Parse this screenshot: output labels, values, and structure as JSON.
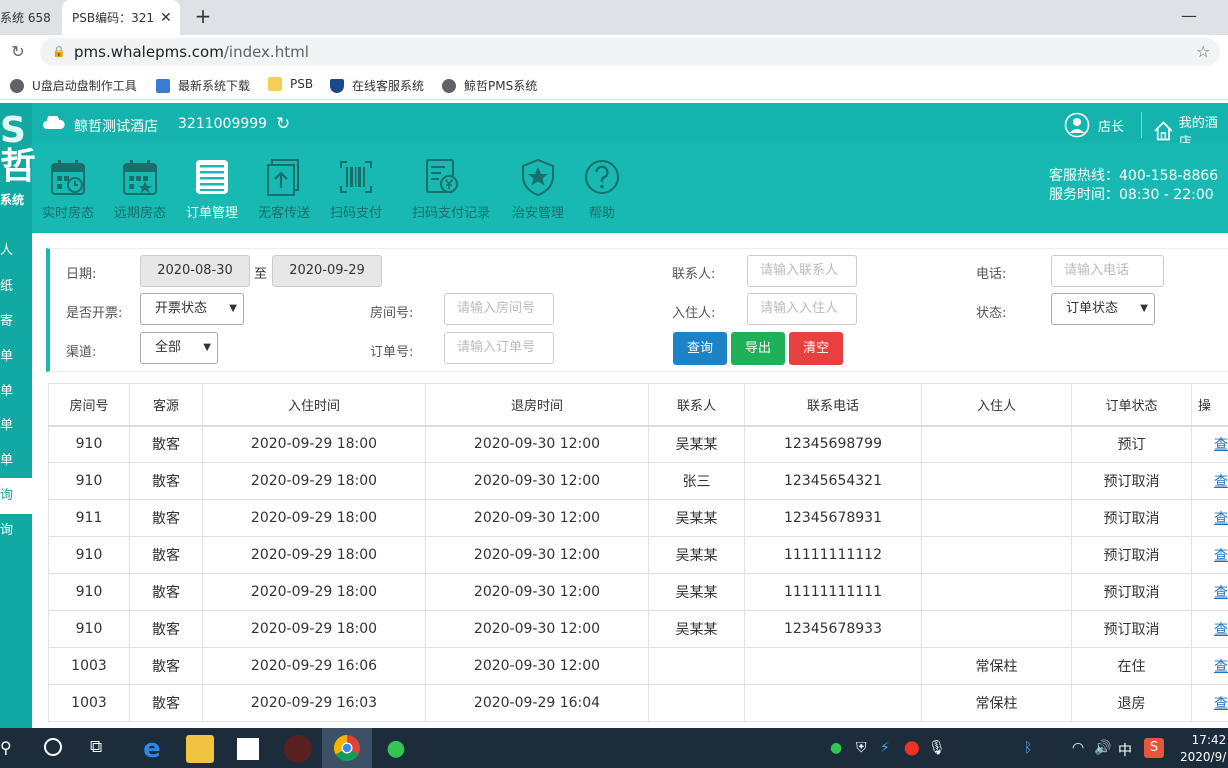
{
  "browser": {
    "tabs": [
      {
        "label": "系统  658",
        "active": false
      },
      {
        "label": "PSB编码：321",
        "active": true
      }
    ],
    "url_host": "pms.whalepms.com",
    "url_path": "/index.html",
    "bookmarks": [
      "U盘启动盘制作工具",
      "最新系统下载",
      "PSB",
      "在线客服系统",
      "鲸哲PMS系统"
    ]
  },
  "header": {
    "hotel_name": "鲸哲测试酒店",
    "hotel_code": "3211009999",
    "user": "店长",
    "my_store": "我的酒店",
    "logo_text": "S 哲",
    "logo_sub": "系统"
  },
  "nav": {
    "items": [
      {
        "label": "实时房态",
        "icon": "calendar-clock-icon"
      },
      {
        "label": "远期房态",
        "icon": "calendar-star-icon"
      },
      {
        "label": "订单管理",
        "icon": "list-icon"
      },
      {
        "label": "无客传送",
        "icon": "upload-icon"
      },
      {
        "label": "扫码支付",
        "icon": "barcode-icon"
      },
      {
        "label": "扫码支付记录",
        "icon": "receipt-yen-icon"
      },
      {
        "label": "治安管理",
        "icon": "shield-star-icon"
      },
      {
        "label": "帮助",
        "icon": "help-icon"
      }
    ],
    "active": "订单管理",
    "hotline": "客服热线：400-158-8866",
    "service_time": "服务时间：08:30 - 22:00"
  },
  "rail": [
    "人",
    "纸",
    "寄",
    "单",
    "单",
    "单",
    "单",
    "询",
    "询"
  ],
  "filter": {
    "date_label": "日期:",
    "date_from": "2020-08-30",
    "date_sep": "至",
    "date_to": "2020-09-29",
    "contact_label": "联系人:",
    "contact_placeholder": "请输入联系人",
    "phone_label": "电话:",
    "phone_placeholder": "请输入电话",
    "invoice_label": "是否开票:",
    "invoice_value": "开票状态",
    "room_label": "房间号:",
    "room_placeholder": "请输入房间号",
    "guest_label": "入住人:",
    "guest_placeholder": "请输入入住人",
    "status_label": "状态:",
    "status_value": "订单状态",
    "channel_label": "渠道:",
    "channel_value": "全部",
    "order_label": "订单号:",
    "order_placeholder": "请输入订单号",
    "btn_query": "查询",
    "btn_export": "导出",
    "btn_clear": "清空"
  },
  "table": {
    "headers": [
      "房间号",
      "客源",
      "入住时间",
      "退房时间",
      "联系人",
      "联系电话",
      "入住人",
      "订单状态",
      "操"
    ],
    "rows": [
      [
        "910",
        "散客",
        "2020-09-29 18:00",
        "2020-09-30 12:00",
        "吴某某",
        "12345698799",
        "",
        "预订",
        "查"
      ],
      [
        "910",
        "散客",
        "2020-09-29 18:00",
        "2020-09-30 12:00",
        "张三",
        "12345654321",
        "",
        "预订取消",
        "查"
      ],
      [
        "911",
        "散客",
        "2020-09-29 18:00",
        "2020-09-30 12:00",
        "吴某某",
        "12345678931",
        "",
        "预订取消",
        "查"
      ],
      [
        "910",
        "散客",
        "2020-09-29 18:00",
        "2020-09-30 12:00",
        "吴某某",
        "11111111112",
        "",
        "预订取消",
        "查"
      ],
      [
        "910",
        "散客",
        "2020-09-29 18:00",
        "2020-09-30 12:00",
        "吴某某",
        "11111111111",
        "",
        "预订取消",
        "查"
      ],
      [
        "910",
        "散客",
        "2020-09-29 18:00",
        "2020-09-30 12:00",
        "吴某某",
        "12345678933",
        "",
        "预订取消",
        "查"
      ],
      [
        "1003",
        "散客",
        "2020-09-29 16:06",
        "2020-09-30 12:00",
        "",
        "",
        "常保柱",
        "在住",
        "查"
      ],
      [
        "1003",
        "散客",
        "2020-09-29 16:03",
        "2020-09-29 16:04",
        "",
        "",
        "常保柱",
        "退房",
        "查"
      ]
    ]
  },
  "taskbar": {
    "time": "17:42",
    "date": "2020/9/",
    "ime": "中"
  },
  "colors": {
    "teal": "#18b9b3",
    "teal_dark": "#13a9a3",
    "btn_query": "#1c83c6",
    "btn_export": "#1fb15a",
    "btn_clear": "#e8403f"
  }
}
